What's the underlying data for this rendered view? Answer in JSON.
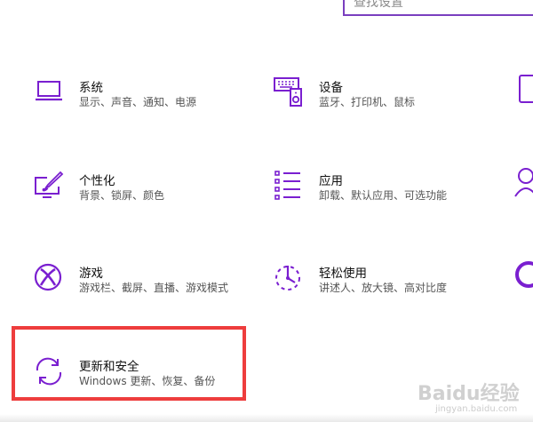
{
  "search": {
    "placeholder": "查找设置"
  },
  "tiles": {
    "system": {
      "title": "系统",
      "desc": "显示、声音、通知、电源"
    },
    "devices": {
      "title": "设备",
      "desc": "蓝牙、打印机、鼠标"
    },
    "personalization": {
      "title": "个性化",
      "desc": "背景、锁屏、颜色"
    },
    "apps": {
      "title": "应用",
      "desc": "卸载、默认应用、可选功能"
    },
    "gaming": {
      "title": "游戏",
      "desc": "游戏栏、截屏、直播、游戏模式"
    },
    "ease": {
      "title": "轻松使用",
      "desc": "讲述人、放大镜、高对比度"
    },
    "update": {
      "title": "更新和安全",
      "desc": "Windows 更新、恢复、备份"
    }
  },
  "watermark": {
    "main": "Baidu经验",
    "sub": "jingyan.baidu.com"
  },
  "colors": {
    "accent": "#7a1fd0",
    "highlight": "#ee3d3d"
  }
}
